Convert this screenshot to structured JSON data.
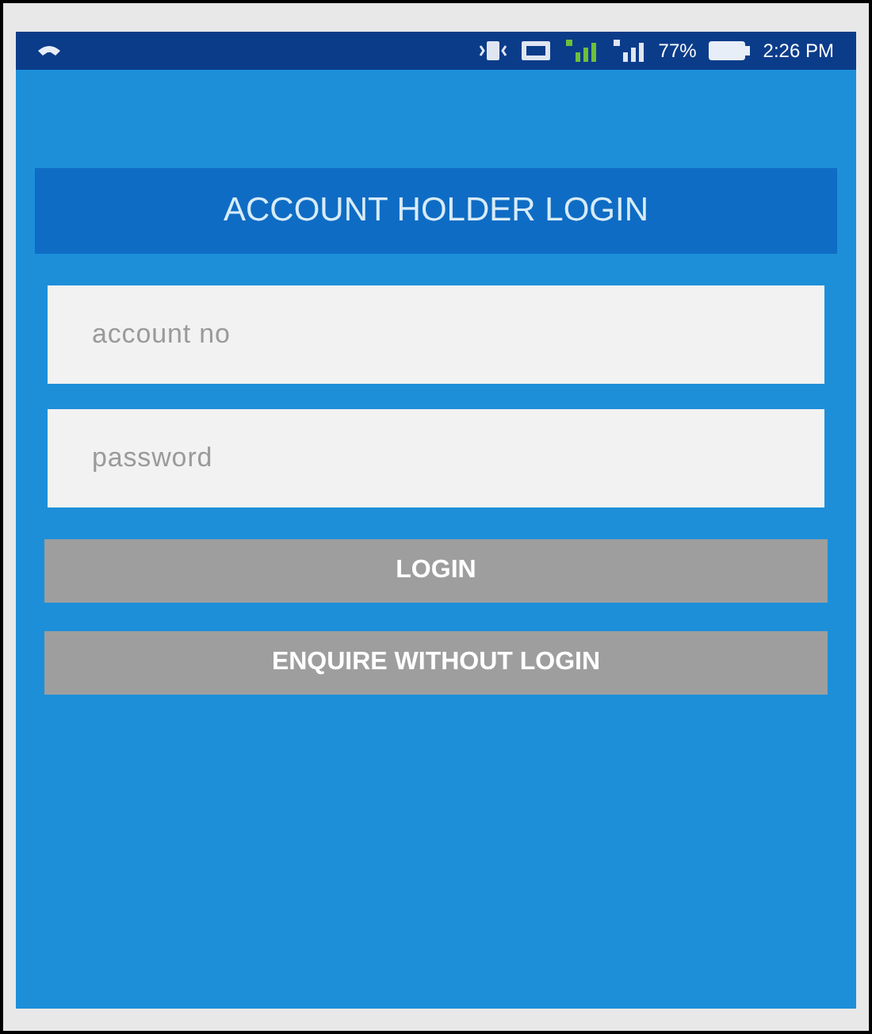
{
  "status_bar": {
    "battery": "77%",
    "time": "2:26 PM"
  },
  "header": {
    "title": "ACCOUNT HOLDER LOGIN"
  },
  "fields": [
    {
      "placeholder": "account no"
    },
    {
      "placeholder": "password"
    }
  ],
  "buttons": [
    {
      "label": "LOGIN",
      "disabled": true
    },
    {
      "label": "ENQUIRE WITHOUT LOGIN",
      "disabled": true
    }
  ]
}
